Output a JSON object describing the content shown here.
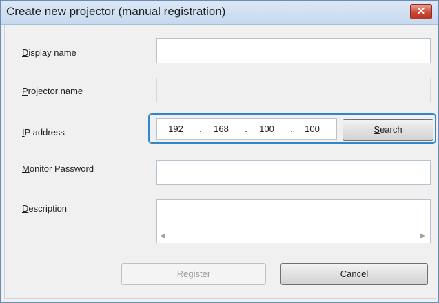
{
  "window": {
    "title": "Create new projector (manual registration)",
    "close_glyph": "✕"
  },
  "form": {
    "display_name": {
      "label": "Display name",
      "mnemonic": "D",
      "value": ""
    },
    "projector_name": {
      "label": "Projector name",
      "mnemonic": "P",
      "value": ""
    },
    "ip_address": {
      "label": "IP address",
      "mnemonic": "I",
      "octets": [
        "192",
        "168",
        "100",
        "100"
      ],
      "separator": "."
    },
    "monitor_password": {
      "label": "Monitor Password",
      "mnemonic": "M",
      "value": ""
    },
    "description": {
      "label": "Description",
      "mnemonic": "D",
      "value": ""
    }
  },
  "buttons": {
    "search": {
      "label": "Search",
      "mnemonic": "S"
    },
    "register": {
      "label": "Register",
      "mnemonic": "R",
      "enabled": false
    },
    "cancel": {
      "label": "Cancel"
    }
  },
  "scrollbar": {
    "left_arrow": "◀",
    "right_arrow": "▶"
  }
}
